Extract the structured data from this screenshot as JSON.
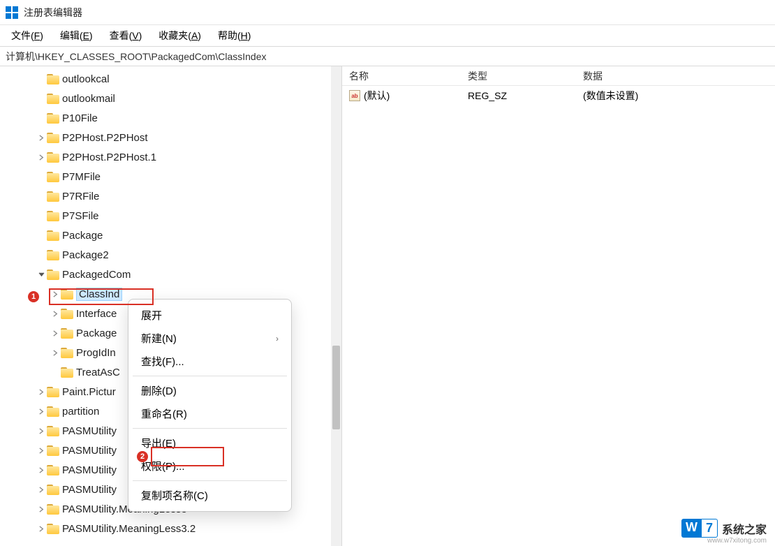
{
  "title": "注册表编辑器",
  "menus": [
    {
      "label": "文件",
      "key": "F"
    },
    {
      "label": "编辑",
      "key": "E"
    },
    {
      "label": "查看",
      "key": "V"
    },
    {
      "label": "收藏夹",
      "key": "A"
    },
    {
      "label": "帮助",
      "key": "H"
    }
  ],
  "path": "计算机\\HKEY_CLASSES_ROOT\\PackagedCom\\ClassIndex",
  "tree": [
    {
      "label": "outlookcal",
      "indent": 3,
      "expander": null
    },
    {
      "label": "outlookmail",
      "indent": 3,
      "expander": null
    },
    {
      "label": "P10File",
      "indent": 3,
      "expander": null
    },
    {
      "label": "P2PHost.P2PHost",
      "indent": 3,
      "expander": "closed"
    },
    {
      "label": "P2PHost.P2PHost.1",
      "indent": 3,
      "expander": "closed"
    },
    {
      "label": "P7MFile",
      "indent": 3,
      "expander": null
    },
    {
      "label": "P7RFile",
      "indent": 3,
      "expander": null
    },
    {
      "label": "P7SFile",
      "indent": 3,
      "expander": null
    },
    {
      "label": "Package",
      "indent": 3,
      "expander": null
    },
    {
      "label": "Package2",
      "indent": 3,
      "expander": null
    },
    {
      "label": "PackagedCom",
      "indent": 3,
      "expander": "open"
    },
    {
      "label": "ClassInd",
      "indent": 4,
      "expander": "closed",
      "selected": true
    },
    {
      "label": "Interface",
      "indent": 4,
      "expander": "closed"
    },
    {
      "label": "Package",
      "indent": 4,
      "expander": "closed"
    },
    {
      "label": "ProgIdIn",
      "indent": 4,
      "expander": "closed"
    },
    {
      "label": "TreatAsC",
      "indent": 4,
      "expander": null
    },
    {
      "label": "Paint.Pictur",
      "indent": 3,
      "expander": "closed"
    },
    {
      "label": "partition",
      "indent": 3,
      "expander": "closed"
    },
    {
      "label": "PASMUtility",
      "indent": 3,
      "expander": "closed"
    },
    {
      "label": "PASMUtility",
      "indent": 3,
      "expander": "closed"
    },
    {
      "label": "PASMUtility",
      "indent": 3,
      "expander": "closed"
    },
    {
      "label": "PASMUtility",
      "indent": 3,
      "expander": "closed"
    },
    {
      "label": "PASMUtility.MeaningLess3",
      "indent": 3,
      "expander": "closed"
    },
    {
      "label": "PASMUtility.MeaningLess3.2",
      "indent": 3,
      "expander": "closed"
    }
  ],
  "list_headers": {
    "name": "名称",
    "type": "类型",
    "data": "数据"
  },
  "list_rows": [
    {
      "name": "(默认)",
      "type": "REG_SZ",
      "data": "(数值未设置)"
    }
  ],
  "context_menu": {
    "items": [
      {
        "label": "展开",
        "sep": false
      },
      {
        "label": "新建(N)",
        "arrow": true,
        "sep": false
      },
      {
        "label": "查找(F)...",
        "sep": true
      },
      {
        "label": "删除(D)",
        "sep": false
      },
      {
        "label": "重命名(R)",
        "sep": true
      },
      {
        "label": "导出(E)",
        "sep": false
      },
      {
        "label": "权限(P)...",
        "sep": true,
        "highlight": true
      },
      {
        "label": "复制项名称(C)",
        "sep": false
      }
    ]
  },
  "watermark": {
    "brand1": "W",
    "brand2": "7",
    "text": "系统之家",
    "url": "www.w7xitong.com"
  },
  "annotations": {
    "badge1": "1",
    "badge2": "2"
  }
}
